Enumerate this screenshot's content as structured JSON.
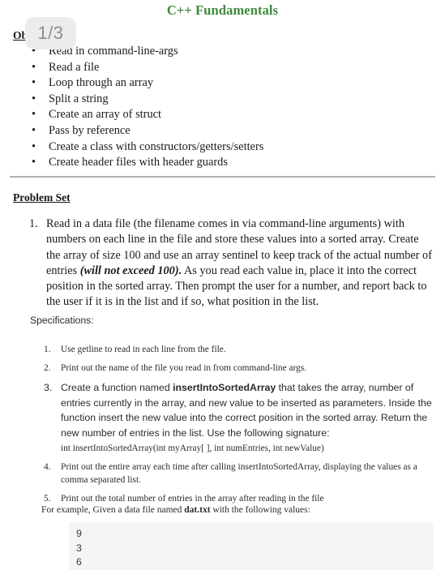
{
  "document": {
    "title": "C++ Fundamentals",
    "title_color": "#3f8a3c"
  },
  "viewer": {
    "page_indicator": "1/3",
    "badge_bg": "#ececec",
    "badge_text_color": "#8e8e8e"
  },
  "objectives": {
    "heading": "Objectives",
    "items": [
      "Read in command-line-args",
      "Read a file",
      "Loop through an array",
      "Split a string",
      "Create an array of struct",
      "Pass by reference",
      "Create a class with constructors/getters/setters",
      "Create header files with header guards"
    ],
    "bullet_glyph": "•"
  },
  "problem_set": {
    "heading": "Problem Set",
    "items": [
      {
        "number": "1.",
        "text_before_italic": "Read in a data file (the filename comes in via command-line arguments) with numbers on each line in the file and store these values into a sorted array. Create the array of size 100 and use an array sentinel to keep track of the actual number of entries ",
        "italic": "(will not exceed 100).",
        "text_after_italic": " As you read each value in, place it into the correct position in the sorted array. Then prompt the user for a number, and report back to the user if it is in the list and if so, what position in the list."
      }
    ]
  },
  "specifications": {
    "label": "Specifications:",
    "items": [
      {
        "number": "1.",
        "style": "serif",
        "text": "Use getline to read in each line from the file."
      },
      {
        "number": "2.",
        "style": "serif",
        "text": "Print out the name of the file you read in from command-line args."
      },
      {
        "number": "3.",
        "style": "sans",
        "text_before_bold": "Create a function named ",
        "bold": "insertIntoSortedArray",
        "text_after_bold": " that takes the array, number of entries currently in the array, and new value to be inserted as parameters. Inside the function insert the new value into the correct position in the sorted array. Return the new number of entries in the list. Use the following signature:",
        "signature": "int insertIntoSortedArray(int myArray[ ], int numEntries, int newValue)"
      },
      {
        "number": "4.",
        "style": "serif",
        "text": "Print out the entire array each time after calling insertIntoSortedArray, displaying the values as a comma separated list."
      },
      {
        "number": "5.",
        "style": "serif",
        "text": "Print out the total number of entries in the array after reading in the file"
      }
    ]
  },
  "example": {
    "intro_before_bold": "For example, Given a data file named ",
    "filename": "dat.txt",
    "intro_after_bold": " with the following values:",
    "code_lines": [
      "9",
      "3",
      "6"
    ],
    "code_bg": "#f5f5f6"
  }
}
